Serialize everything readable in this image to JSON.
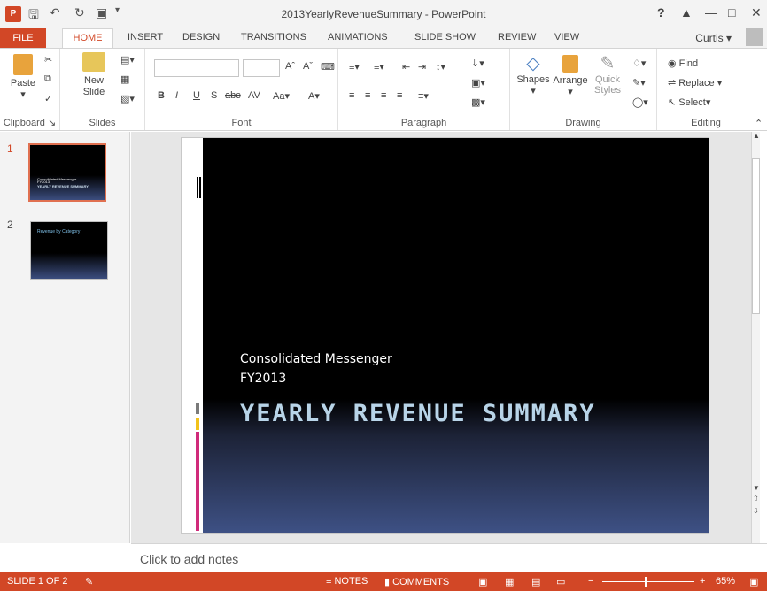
{
  "window": {
    "title": "2013YearlyRevenueSummary - PowerPoint",
    "help": "?",
    "user": "Curtis"
  },
  "tabs": [
    "FILE",
    "HOME",
    "INSERT",
    "DESIGN",
    "TRANSITIONS",
    "ANIMATIONS",
    "SLIDE SHOW",
    "REVIEW",
    "VIEW"
  ],
  "ribbon": {
    "clipboard": {
      "label": "Clipboard",
      "paste": "Paste"
    },
    "slides": {
      "label": "Slides",
      "new_slide": "New Slide"
    },
    "font": {
      "label": "Font"
    },
    "paragraph": {
      "label": "Paragraph"
    },
    "drawing": {
      "label": "Drawing",
      "shapes": "Shapes",
      "arrange": "Arrange",
      "quick_styles": "Quick Styles"
    },
    "editing": {
      "label": "Editing",
      "find": "Find",
      "replace": "Replace",
      "select": "Select"
    }
  },
  "thumbnails": [
    {
      "number": "1",
      "line1": "Consolidated Messenger",
      "line2": "FY2013",
      "title": "YEARLY REVENUE SUMMARY"
    },
    {
      "number": "2",
      "title": "Revenue by Category"
    }
  ],
  "slide": {
    "subtitle_line1": "Consolidated Messenger",
    "subtitle_line2": "FY2013",
    "title": "YEARLY REVENUE SUMMARY"
  },
  "notes": {
    "placeholder": "Click to add notes"
  },
  "status": {
    "slide_indicator": "SLIDE 1 OF 2",
    "notes": "NOTES",
    "comments": "COMMENTS",
    "zoom": "65%"
  },
  "colors": {
    "accent": "#d24726"
  }
}
